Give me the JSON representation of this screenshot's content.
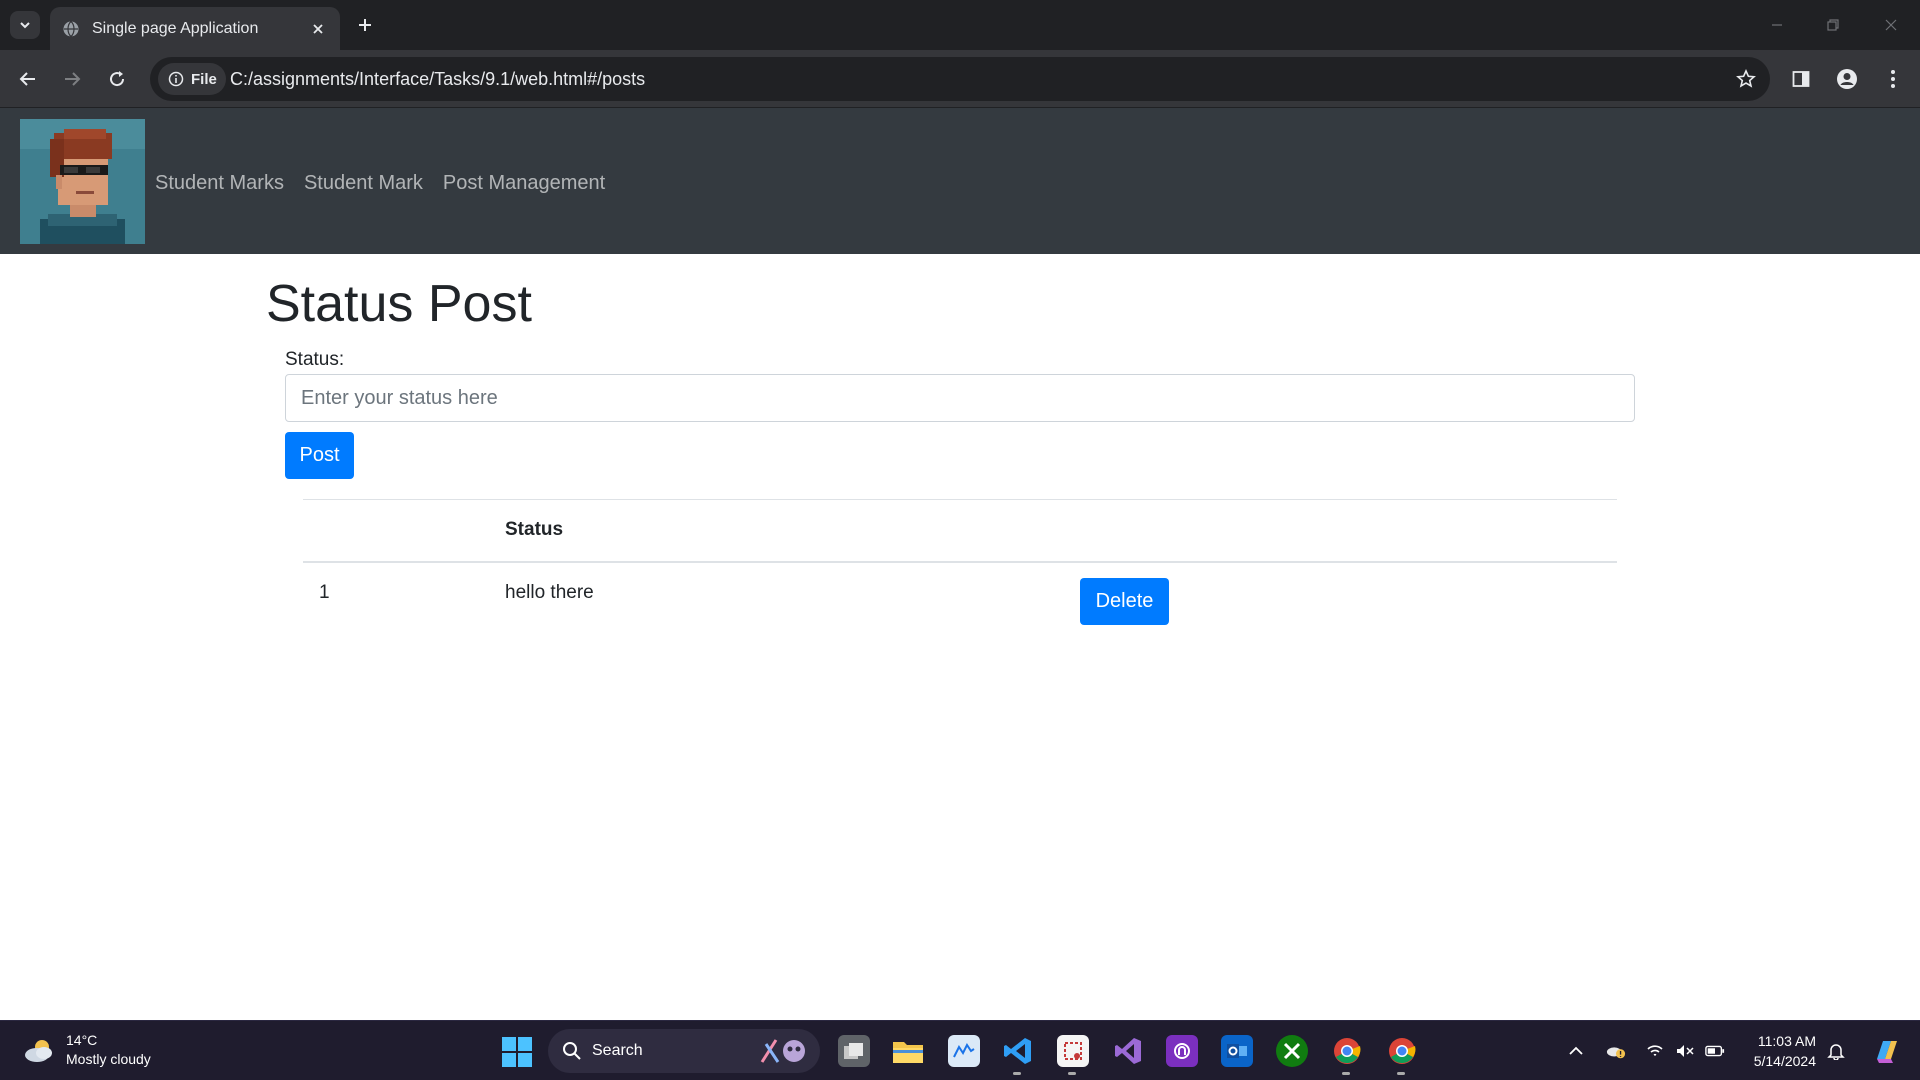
{
  "browser": {
    "tab_title": "Single page Application",
    "site_chip": "File",
    "url": "C:/assignments/Interface/Tasks/9.1/web.html#/posts"
  },
  "navbar": {
    "links": [
      "Student Marks",
      "Student Mark",
      "Post Management"
    ]
  },
  "main": {
    "title": "Status Post",
    "status_label": "Status:",
    "status_placeholder": "Enter your status here",
    "post_button": "Post",
    "table": {
      "headers": [
        "",
        "Status",
        ""
      ],
      "rows": [
        {
          "id": "1",
          "status": "hello there",
          "action": "Delete"
        }
      ]
    }
  },
  "taskbar": {
    "weather_temp": "14°C",
    "weather_desc": "Mostly cloudy",
    "search_label": "Search",
    "time": "11:03 AM",
    "date": "5/14/2024"
  },
  "colors": {
    "primary": "#007bff",
    "navbar_bg": "#343a40",
    "chrome_bg": "#202124"
  }
}
